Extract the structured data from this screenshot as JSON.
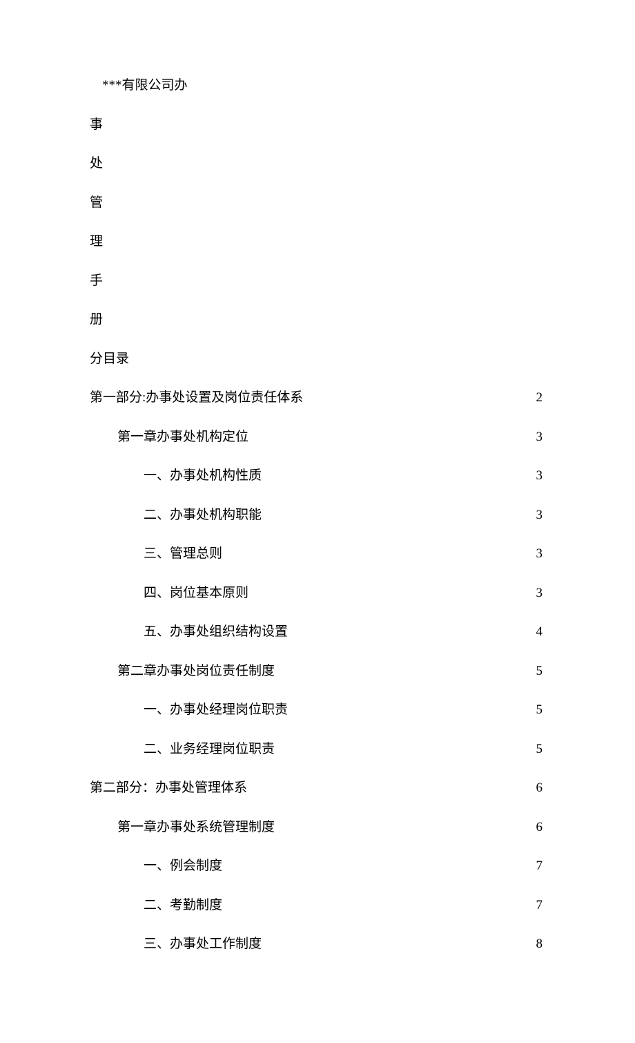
{
  "title_parts": [
    "***有限公司办",
    "事",
    "处",
    "管",
    "理",
    "手",
    "册"
  ],
  "subtitle": "分目录",
  "toc": [
    {
      "label": "第一部分:办事处设置及岗位责任体系",
      "page": "2",
      "indent": 0
    },
    {
      "label": "第一章办事处机构定位 ",
      "page": "3",
      "indent": 1
    },
    {
      "label": "一、办事处机构性质",
      "page": "3",
      "indent": 2
    },
    {
      "label": "二、办事处机构职能",
      "page": "3",
      "indent": 2
    },
    {
      "label": "三、管理总则",
      "page": "3",
      "indent": 2
    },
    {
      "label": "四、岗位基本原则",
      "page": "3",
      "indent": 2
    },
    {
      "label": "五、办事处组织结构设置",
      "page": "4",
      "indent": 2
    },
    {
      "label": "第二章办事处岗位责任制度 ",
      "page": "5",
      "indent": 1
    },
    {
      "label": "一、办事处经理岗位职责",
      "page": "5",
      "indent": 2
    },
    {
      "label": "二、业务经理岗位职责",
      "page": "5",
      "indent": 2
    },
    {
      "label": "第二部分：办事处管理体系",
      "page": "6",
      "indent": 0
    },
    {
      "label": "第一章办事处系统管理制度 ",
      "page": "6",
      "indent": 1
    },
    {
      "label": "一、例会制度",
      "page": "7",
      "indent": 2
    },
    {
      "label": "二、考勤制度",
      "page": "7",
      "indent": 2
    },
    {
      "label": "三、办事处工作制度",
      "page": "8",
      "indent": 2
    }
  ]
}
